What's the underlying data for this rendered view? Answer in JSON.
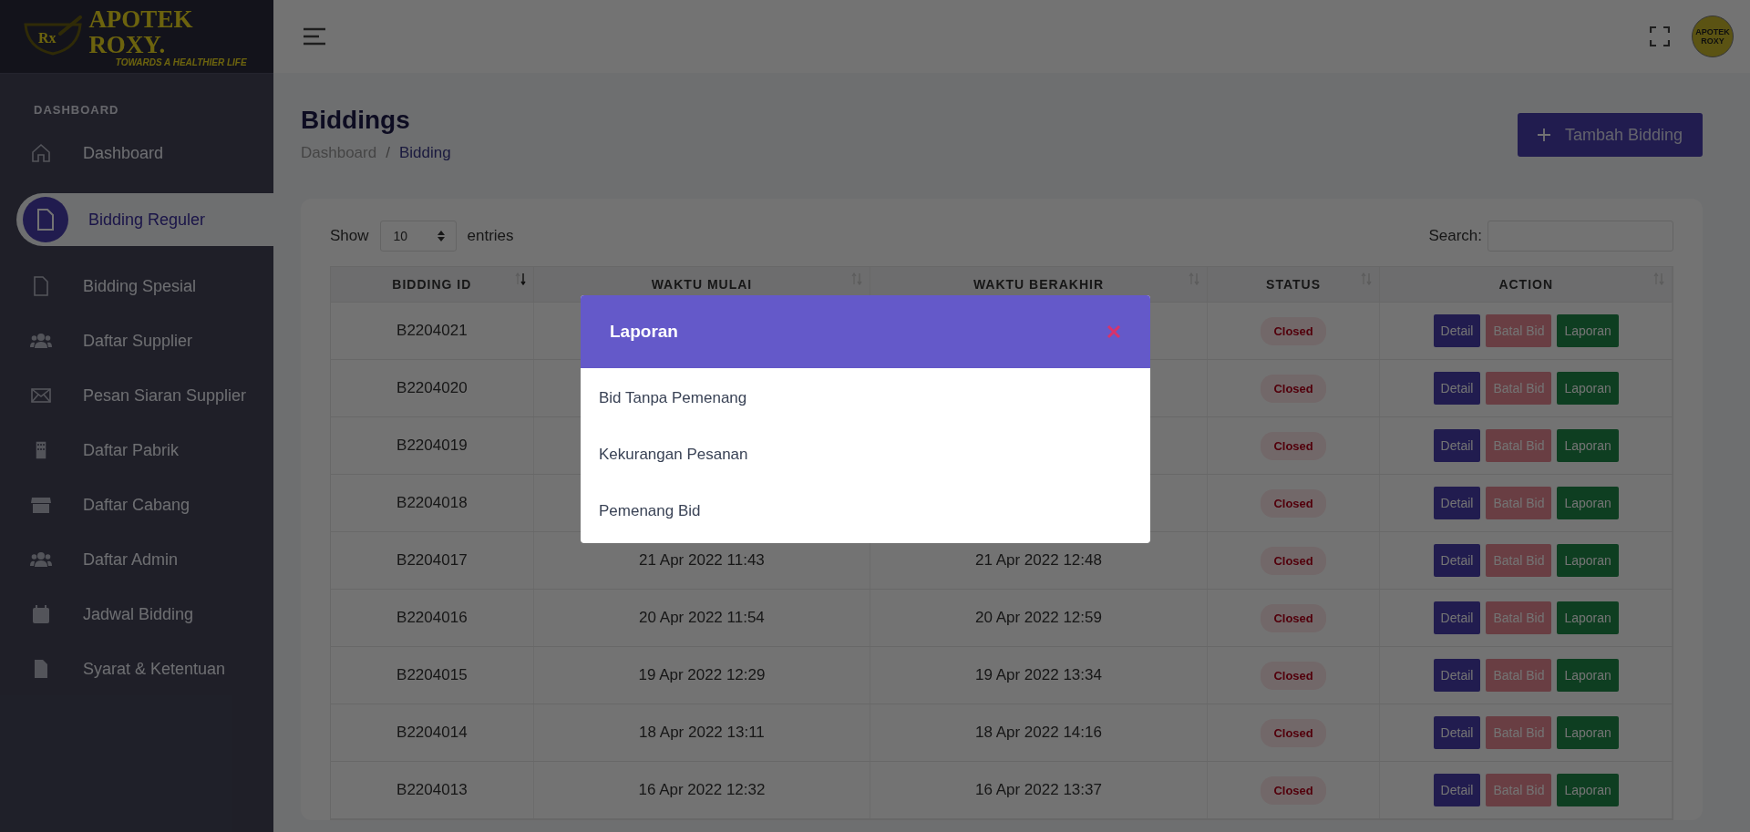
{
  "logo": {
    "mark": "Rx",
    "name": "APOTEK ROXY.",
    "tagline": "TOWARDS A HEALTHIER LIFE"
  },
  "sidebar": {
    "section": "DASHBOARD",
    "items": [
      {
        "label": "Dashboard",
        "selected": false
      },
      {
        "label": "Bidding Reguler",
        "selected": true
      },
      {
        "label": "Bidding Spesial",
        "selected": false
      },
      {
        "label": "Daftar Supplier",
        "selected": false
      },
      {
        "label": "Pesan Siaran Supplier",
        "selected": false
      },
      {
        "label": "Daftar Pabrik",
        "selected": false
      },
      {
        "label": "Daftar Cabang",
        "selected": false
      },
      {
        "label": "Daftar Admin",
        "selected": false
      },
      {
        "label": "Jadwal Bidding",
        "selected": false
      },
      {
        "label": "Syarat & Ketentuan",
        "selected": false
      }
    ]
  },
  "header": {
    "avatar_text": "APOTEK ROXY"
  },
  "page": {
    "title": "Biddings",
    "breadcrumb": [
      "Dashboard",
      "Bidding"
    ],
    "breadcrumb_separator": "/",
    "add_button": "Tambah Bidding"
  },
  "table_controls": {
    "show_label": "Show",
    "page_size": "10",
    "entries_label": "entries",
    "search_label": "Search:"
  },
  "table": {
    "columns": [
      {
        "label": "BIDDING ID",
        "sorted": true
      },
      {
        "label": "WAKTU MULAI",
        "sorted": false
      },
      {
        "label": "WAKTU BERAKHIR",
        "sorted": false
      },
      {
        "label": "STATUS",
        "sorted": false
      },
      {
        "label": "ACTION",
        "sorted": false
      }
    ],
    "rows": [
      {
        "id": "B2204021",
        "status": "Closed",
        "actions": [
          {
            "label": "Detail",
            "kind": "detail",
            "disabled": false
          },
          {
            "label": "Batal Bid",
            "kind": "cancel",
            "disabled": true
          },
          {
            "label": "Laporan",
            "kind": "report",
            "disabled": false
          }
        ]
      },
      {
        "id": "B2204020",
        "status": "Closed",
        "actions": [
          {
            "label": "Detail",
            "kind": "detail",
            "disabled": false
          },
          {
            "label": "Batal Bid",
            "kind": "cancel",
            "disabled": true
          },
          {
            "label": "Laporan",
            "kind": "report",
            "disabled": false
          }
        ]
      },
      {
        "id": "B2204019",
        "status": "Closed",
        "actions": [
          {
            "label": "Detail",
            "kind": "detail",
            "disabled": false
          },
          {
            "label": "Batal Bid",
            "kind": "cancel",
            "disabled": true
          },
          {
            "label": "Laporan",
            "kind": "report",
            "disabled": false
          }
        ]
      },
      {
        "id": "B2204018",
        "status": "Closed",
        "actions": [
          {
            "label": "Detail",
            "kind": "detail",
            "disabled": false
          },
          {
            "label": "Batal Bid",
            "kind": "cancel",
            "disabled": true
          },
          {
            "label": "Laporan",
            "kind": "report",
            "disabled": false
          }
        ]
      },
      {
        "id": "B2204017",
        "start": "21 Apr 2022 11:43",
        "end": "21 Apr 2022 12:48",
        "status": "Closed",
        "actions": [
          {
            "label": "Detail",
            "kind": "detail",
            "disabled": false
          },
          {
            "label": "Batal Bid",
            "kind": "cancel",
            "disabled": true
          },
          {
            "label": "Laporan",
            "kind": "report",
            "disabled": false
          }
        ]
      },
      {
        "id": "B2204016",
        "start": "20 Apr 2022 11:54",
        "end": "20 Apr 2022 12:59",
        "status": "Closed",
        "actions": [
          {
            "label": "Detail",
            "kind": "detail",
            "disabled": false
          },
          {
            "label": "Batal Bid",
            "kind": "cancel",
            "disabled": true
          },
          {
            "label": "Laporan",
            "kind": "report",
            "disabled": false
          }
        ]
      },
      {
        "id": "B2204015",
        "start": "19 Apr 2022 12:29",
        "end": "19 Apr 2022 13:34",
        "status": "Closed",
        "actions": [
          {
            "label": "Detail",
            "kind": "detail",
            "disabled": false
          },
          {
            "label": "Batal Bid",
            "kind": "cancel",
            "disabled": true
          },
          {
            "label": "Laporan",
            "kind": "report",
            "disabled": false
          }
        ]
      },
      {
        "id": "B2204014",
        "start": "18 Apr 2022 13:11",
        "end": "18 Apr 2022 14:16",
        "status": "Closed",
        "actions": [
          {
            "label": "Detail",
            "kind": "detail",
            "disabled": false
          },
          {
            "label": "Batal Bid",
            "kind": "cancel",
            "disabled": true
          },
          {
            "label": "Laporan",
            "kind": "report",
            "disabled": false
          }
        ]
      },
      {
        "id": "B2204013",
        "start": "16 Apr 2022 12:32",
        "end": "16 Apr 2022 13:37",
        "status": "Closed",
        "actions": [
          {
            "label": "Detail",
            "kind": "detail",
            "disabled": false
          },
          {
            "label": "Batal Bid",
            "kind": "cancel",
            "disabled": true
          },
          {
            "label": "Laporan",
            "kind": "report",
            "disabled": false
          }
        ]
      }
    ]
  },
  "modal": {
    "title": "Laporan",
    "items": [
      "Bid Tanpa Pemenang",
      "Kekurangan Pesanan",
      "Pemenang Bid"
    ]
  }
}
